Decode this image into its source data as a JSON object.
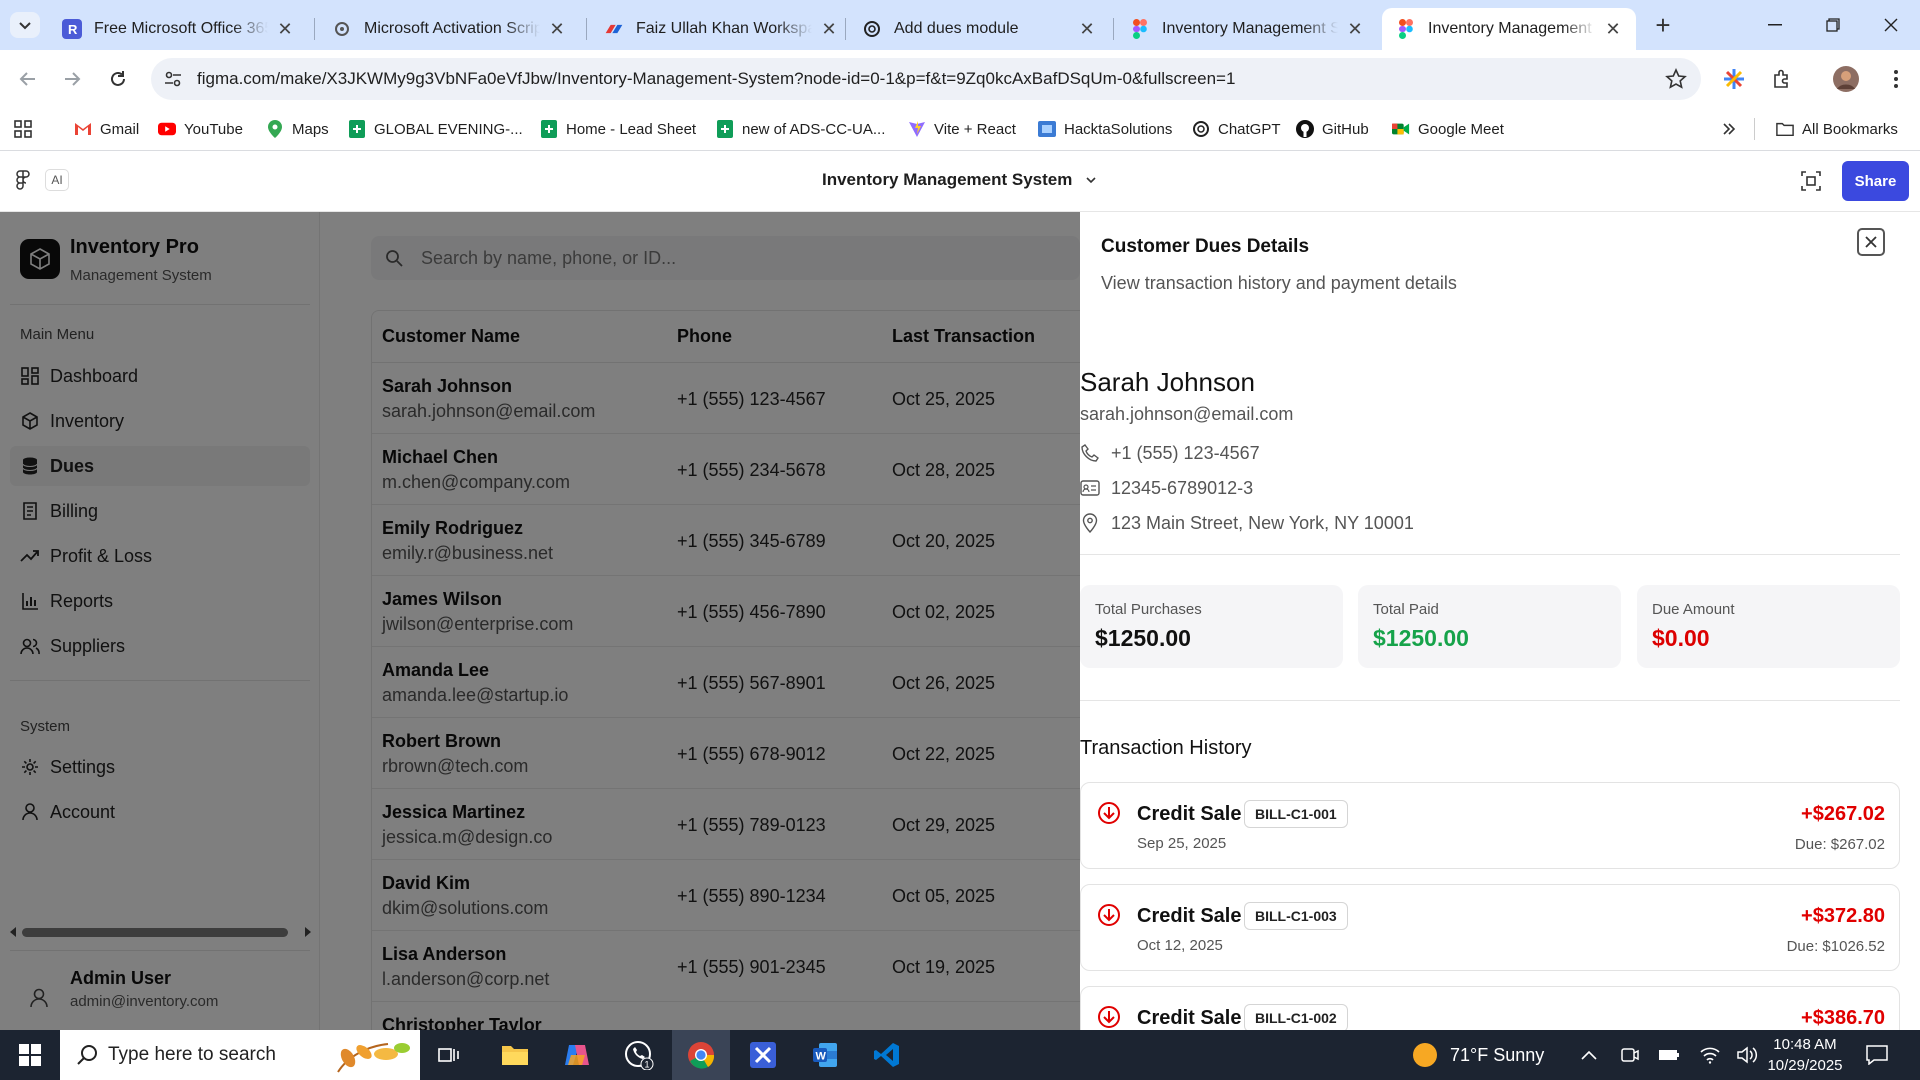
{
  "browser": {
    "tabs": [
      {
        "title": "Free Microsoft Office 365 F",
        "icon": "r-app-icon"
      },
      {
        "title": "Microsoft Activation Script",
        "icon": "gear-icon"
      },
      {
        "title": "Faiz Ullah Khan Workspace",
        "icon": "workspace-icon"
      },
      {
        "title": "Add dues module",
        "icon": "chatgpt-icon"
      },
      {
        "title": "Inventory Management Sy",
        "icon": "figma-icon"
      },
      {
        "title": "Inventory Management Sy",
        "icon": "figma-icon",
        "active": true
      }
    ],
    "url": "figma.com/make/X3JKWMy9g3VbNFa0eVfJbw/Inventory-Management-System?node-id=0-1&p=f&t=9Zq0kcAxBafDSqUm-0&fullscreen=1",
    "bookmarks": [
      "Gmail",
      "YouTube",
      "Maps",
      "GLOBAL EVENING-...",
      "Home - Lead Sheet",
      "new of ADS-CC-UA...",
      "Vite + React",
      "HacktaSolutions",
      "ChatGPT",
      "GitHub",
      "Google Meet"
    ],
    "all_bookmarks": "All Bookmarks"
  },
  "figma": {
    "ai_label": "AI",
    "project_title": "Inventory Management System",
    "share_label": "Share"
  },
  "sidebar": {
    "app_name": "Inventory Pro",
    "app_subtitle": "Management System",
    "main_menu_title": "Main Menu",
    "main_items": [
      {
        "label": "Dashboard",
        "icon": "grid-icon"
      },
      {
        "label": "Inventory",
        "icon": "box-icon"
      },
      {
        "label": "Dues",
        "icon": "database-icon",
        "active": true
      },
      {
        "label": "Billing",
        "icon": "receipt-icon"
      },
      {
        "label": "Profit & Loss",
        "icon": "trend-up-icon"
      },
      {
        "label": "Reports",
        "icon": "bar-chart-icon"
      },
      {
        "label": "Suppliers",
        "icon": "users-icon"
      }
    ],
    "system_title": "System",
    "system_items": [
      {
        "label": "Settings",
        "icon": "gear-icon"
      },
      {
        "label": "Account",
        "icon": "user-icon"
      }
    ],
    "user": {
      "name": "Admin User",
      "email": "admin@inventory.com"
    }
  },
  "main": {
    "search_placeholder": "Search by name, phone, or ID...",
    "columns": [
      "Customer Name",
      "Phone",
      "Last Transaction"
    ],
    "rows": [
      {
        "name": "Sarah Johnson",
        "email": "sarah.johnson@email.com",
        "phone": "+1 (555) 123-4567",
        "date": "Oct 25, 2025"
      },
      {
        "name": "Michael Chen",
        "email": "m.chen@company.com",
        "phone": "+1 (555) 234-5678",
        "date": "Oct 28, 2025"
      },
      {
        "name": "Emily Rodriguez",
        "email": "emily.r@business.net",
        "phone": "+1 (555) 345-6789",
        "date": "Oct 20, 2025"
      },
      {
        "name": "James Wilson",
        "email": "jwilson@enterprise.com",
        "phone": "+1 (555) 456-7890",
        "date": "Oct 02, 2025"
      },
      {
        "name": "Amanda Lee",
        "email": "amanda.lee@startup.io",
        "phone": "+1 (555) 567-8901",
        "date": "Oct 26, 2025"
      },
      {
        "name": "Robert Brown",
        "email": "rbrown@tech.com",
        "phone": "+1 (555) 678-9012",
        "date": "Oct 22, 2025"
      },
      {
        "name": "Jessica Martinez",
        "email": "jessica.m@design.co",
        "phone": "+1 (555) 789-0123",
        "date": "Oct 29, 2025"
      },
      {
        "name": "David Kim",
        "email": "dkim@solutions.com",
        "phone": "+1 (555) 890-1234",
        "date": "Oct 05, 2025"
      },
      {
        "name": "Lisa Anderson",
        "email": "l.anderson@corp.net",
        "phone": "+1 (555) 901-2345",
        "date": "Oct 19, 2025"
      },
      {
        "name": "Christopher Taylor",
        "email": "",
        "phone": "",
        "date": ""
      }
    ]
  },
  "drawer": {
    "title": "Customer Dues Details",
    "subtitle": "View transaction history and payment details",
    "customer": {
      "name": "Sarah Johnson",
      "email": "sarah.johnson@email.com",
      "phone": "+1 (555) 123-4567",
      "id": "12345-6789012-3",
      "address": "123 Main Street, New York, NY 10001"
    },
    "stats": [
      {
        "label": "Total Purchases",
        "value": "$1250.00",
        "color": "#111111"
      },
      {
        "label": "Total Paid",
        "value": "$1250.00",
        "color": "#16a34a"
      },
      {
        "label": "Due Amount",
        "value": "$0.00",
        "color": "#dc0000"
      }
    ],
    "history_title": "Transaction History",
    "transactions": [
      {
        "type": "Credit Sale",
        "bill": "BILL-C1-001",
        "date": "Sep 25, 2025",
        "amount": "+$267.02",
        "due": "Due: $267.02"
      },
      {
        "type": "Credit Sale",
        "bill": "BILL-C1-003",
        "date": "Oct 12, 2025",
        "amount": "+$372.80",
        "due": "Due: $1026.52"
      },
      {
        "type": "Credit Sale",
        "bill": "BILL-C1-002",
        "date": "",
        "amount": "+$386.70",
        "due": ""
      }
    ]
  },
  "taskbar": {
    "search_placeholder": "Type here to search",
    "weather": "71°F  Sunny",
    "time": "10:48 AM",
    "date": "10/29/2025",
    "whatsapp_badge": "1"
  },
  "colors": {
    "accent": "#3b49df",
    "tabbar": "#d3e3fd",
    "due_red": "#dc0000",
    "paid_green": "#16a34a"
  }
}
